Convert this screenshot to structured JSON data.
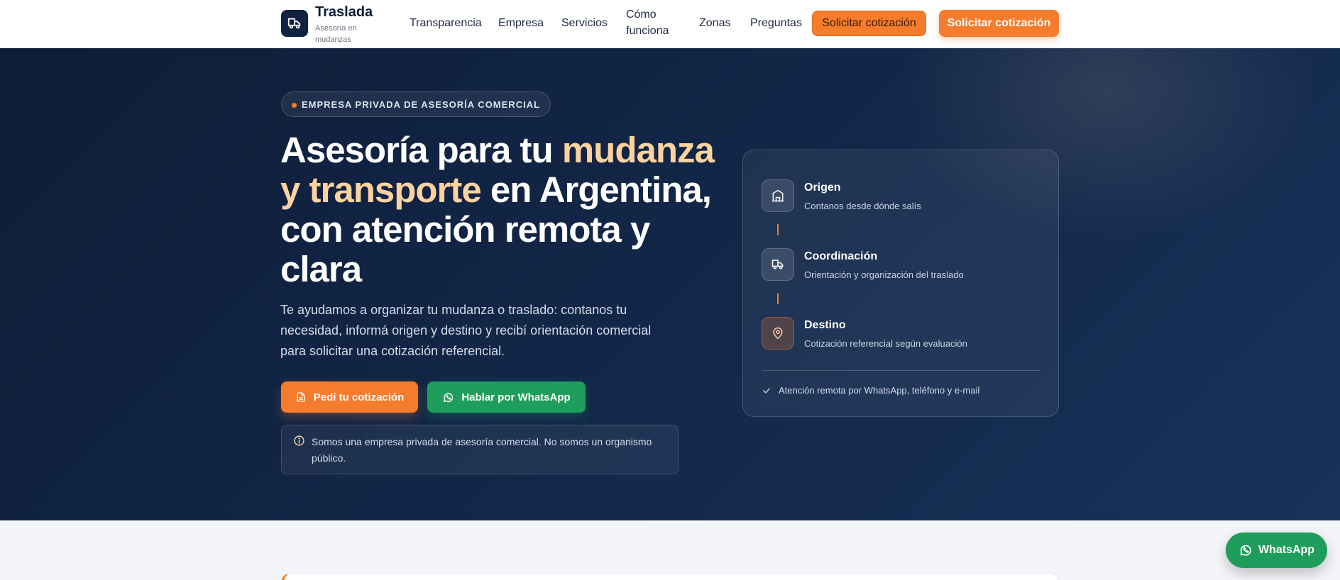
{
  "brand": {
    "name": "Traslada",
    "tagline": "Asesoría en mudanzas",
    "icon": "truck-icon"
  },
  "nav": {
    "items": [
      {
        "label": "Transparencia"
      },
      {
        "label": "Empresa"
      },
      {
        "label": "Servicios"
      },
      {
        "label": "Cómo funciona"
      },
      {
        "label": "Zonas"
      },
      {
        "label": "Preguntas"
      }
    ],
    "cta_secondary": "Solicitar cotización",
    "cta_primary": "Solicitar cotización"
  },
  "hero": {
    "eyebrow": "EMPRESA PRIVADA DE ASESORÍA COMERCIAL",
    "headline_part1": "Asesoría para tu ",
    "headline_accent": "mudanza y transporte",
    "headline_part2": " en Argentina, con atención remota y clara",
    "lead": "Te ayudamos a organizar tu mudanza o traslado: contanos tu necesidad, informá origen y destino y recibí orientación comercial para solicitar una cotización referencial.",
    "btn_quote": "Pedí tu cotización",
    "btn_whatsapp": "Hablar por WhatsApp",
    "notice": "Somos una empresa privada de asesoría comercial. No somos un organismo público."
  },
  "card": {
    "steps": [
      {
        "title": "Origen",
        "desc": "Contanos desde dónde salís",
        "icon": "building-icon"
      },
      {
        "title": "Coordinación",
        "desc": "Orientación y organización del traslado",
        "icon": "truck-icon"
      },
      {
        "title": "Destino",
        "desc": "Cotización referencial según evaluación",
        "icon": "map-pin-icon"
      }
    ],
    "footer": "Atención remota por WhatsApp, teléfono y e-mail"
  },
  "floating": {
    "whatsapp_label": "WhatsApp"
  },
  "colors": {
    "accent": "#f47c2c",
    "navy": "#10223f",
    "whatsapp": "#1f9d5c",
    "highlight": "#fcd29f"
  }
}
